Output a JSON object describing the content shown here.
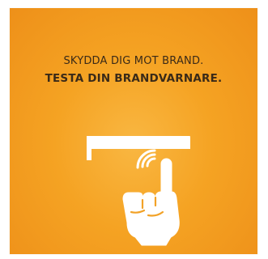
{
  "poster": {
    "line1": "SKYDDA DIG MOT BRAND.",
    "line2": "TESTA DIN BRANDVARNARE."
  },
  "colors": {
    "background_center": "#f9b742",
    "background_edge": "#ee9019",
    "text": "#3a2a18",
    "illustration": "#ffffff"
  },
  "icons": {
    "smoke_detector": "smoke-detector-icon",
    "signal": "signal-waves-icon",
    "hand": "pointing-hand-icon"
  }
}
